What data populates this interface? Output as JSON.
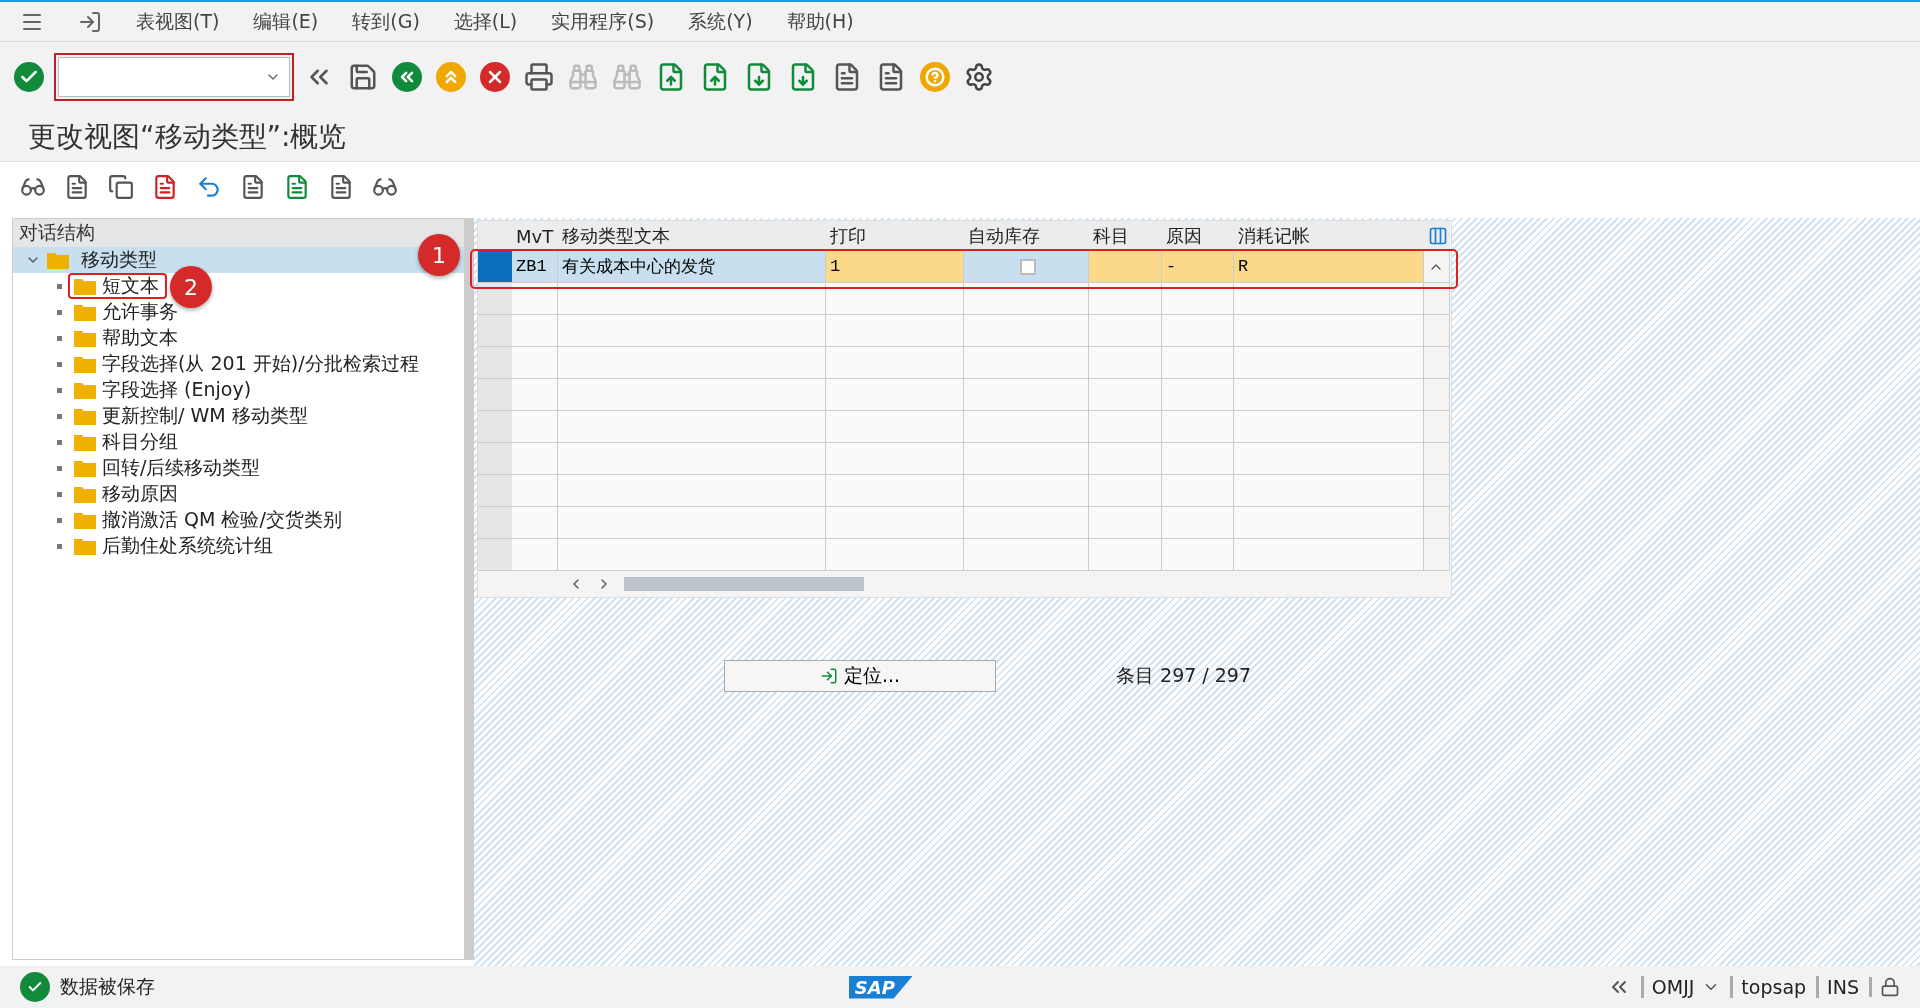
{
  "menu": [
    "表视图(T)",
    "编辑(E)",
    "转到(G)",
    "选择(L)",
    "实用程序(S)",
    "系统(Y)",
    "帮助(H)"
  ],
  "title": "更改视图“移动类型”:概览",
  "tree": {
    "header": "对话结构",
    "items": [
      {
        "label": "移动类型",
        "expanded": true,
        "selected": true,
        "highlighted": false,
        "children": [
          {
            "label": "短文本",
            "selected": false,
            "highlighted": true
          },
          {
            "label": "允许事务",
            "selected": false,
            "highlighted": false
          },
          {
            "label": "帮助文本",
            "selected": false,
            "highlighted": false
          },
          {
            "label": "字段选择(从 201 开始)/分批检索过程",
            "selected": false,
            "highlighted": false
          },
          {
            "label": "字段选择 (Enjoy)",
            "selected": false,
            "highlighted": false
          },
          {
            "label": "更新控制/ WM 移动类型",
            "selected": false,
            "highlighted": false
          },
          {
            "label": "科目分组",
            "selected": false,
            "highlighted": false
          },
          {
            "label": "回转/后续移动类型",
            "selected": false,
            "highlighted": false
          },
          {
            "label": "移动原因",
            "selected": false,
            "highlighted": false
          },
          {
            "label": "撤消激活 QM 检验/交货类别",
            "selected": false,
            "highlighted": false
          },
          {
            "label": "后勤住处系统统计组",
            "selected": false,
            "highlighted": false
          }
        ]
      }
    ]
  },
  "table": {
    "columns": [
      {
        "label": "MvT",
        "kind": "key"
      },
      {
        "label": "移动类型文本",
        "kind": "key"
      },
      {
        "label": "打印",
        "kind": "input"
      },
      {
        "label": "自动库存",
        "kind": "checkbox"
      },
      {
        "label": "科目",
        "kind": "input"
      },
      {
        "label": "原因",
        "kind": "input"
      },
      {
        "label": "消耗记帐",
        "kind": "input"
      }
    ],
    "rows": [
      {
        "selected": true,
        "highlighted": true,
        "cells": [
          {
            "text": "ZB1"
          },
          {
            "text": "有关成本中心的发货"
          },
          {
            "text": "1"
          },
          {
            "checked": false
          },
          {
            "text": ""
          },
          {
            "text": "-"
          },
          {
            "text": "R"
          }
        ]
      }
    ]
  },
  "locate_button": "定位...",
  "entries": "条目 297 / 297",
  "annotations": [
    {
      "label": "1"
    },
    {
      "label": "2"
    }
  ],
  "status_bar": {
    "message": "数据被保存",
    "logo": "SAP",
    "transaction": "OMJJ",
    "user": "topsap",
    "mode": "INS"
  }
}
